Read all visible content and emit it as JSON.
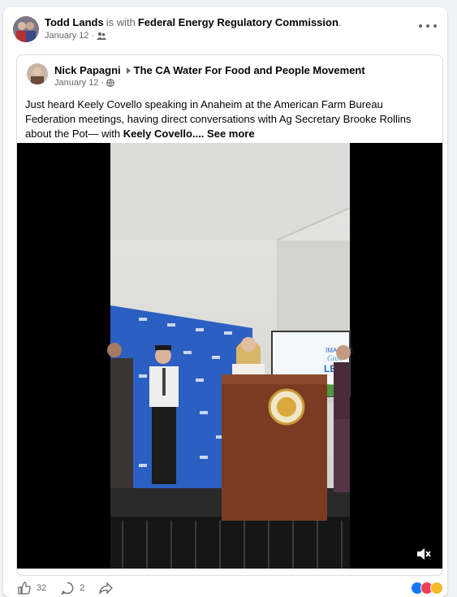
{
  "post": {
    "author": "Todd Lands",
    "with_text": "is with",
    "page": "Federal Energy Regulatory Commission",
    "period": ".",
    "date": "January 12",
    "privacy_icon": "friends-icon",
    "more_icon": "more-options-icon"
  },
  "shared": {
    "author": "Nick Papagni",
    "group": "The CA Water For Food and People Movement",
    "date": "January 12",
    "privacy_icon": "globe-icon",
    "text_part1": "Just heard Keely Covello speaking in Anaheim at the American Farm Bureau Federation meetings, having direct conversations with Ag Secretary Brooke Rollins about the Pot— with",
    "mention": "Keely Covello",
    "ellipsis": "....",
    "see_more": "See more",
    "screen_text_imagine": "IMAGINE",
    "screen_text_grow": "Grow",
    "screen_text_lead": "LEAD"
  },
  "actions": {
    "like_count": "32",
    "comment_count": "2"
  }
}
